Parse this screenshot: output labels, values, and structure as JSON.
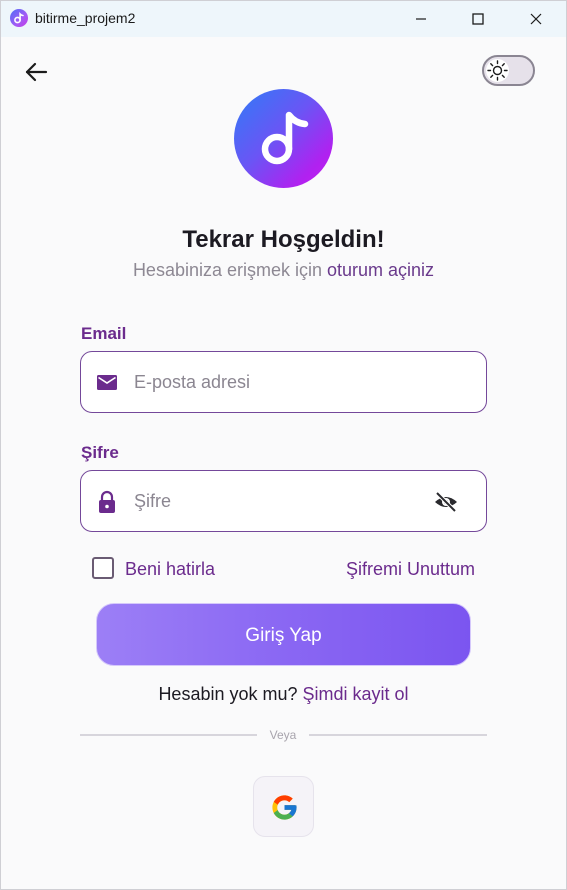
{
  "window": {
    "title": "bitirme_projem2"
  },
  "header": {
    "title": "Tekrar Hoşgeldin!",
    "subtitle_prefix": "Hesabiniza erişmek için ",
    "subtitle_accent": "oturum açiniz"
  },
  "form": {
    "email_label": "Email",
    "email_placeholder": "E-posta adresi",
    "password_label": "Şifre",
    "password_placeholder": "Şifre",
    "remember_label": "Beni hatirla",
    "remember_checked": false,
    "forgot_label": "Şifremi Unuttum",
    "login_label": "Giriş Yap"
  },
  "signup": {
    "prompt": "Hesabin yok mu? ",
    "link": "Şimdi kayit ol"
  },
  "divider": {
    "text": "Veya"
  },
  "icons": {
    "back": "arrow-left-icon",
    "theme": "sun-icon",
    "logo": "music-note-icon",
    "email": "mail-icon",
    "password": "lock-icon",
    "visibility": "eye-off-icon",
    "social": "google-icon"
  },
  "colors": {
    "accent": "#6b2b8d",
    "button_start": "#9c7ff6",
    "button_end": "#7b55f0",
    "logo_start": "#2f7cf6",
    "logo_end": "#c81ff0"
  }
}
